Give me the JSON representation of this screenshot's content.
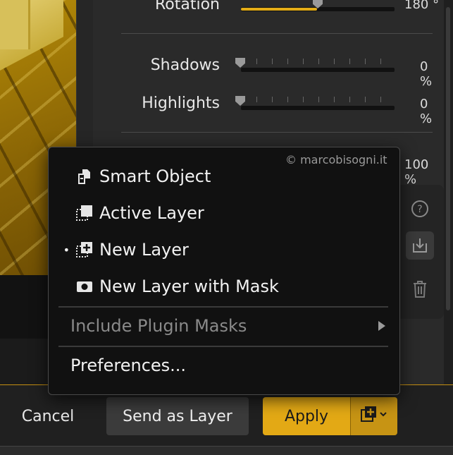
{
  "sliders": [
    {
      "label": "Rotation",
      "value": "180 °",
      "fill": 0.5
    },
    {
      "label": "Shadows",
      "value": "0 %",
      "fill": 0
    },
    {
      "label": "Highlights",
      "value": "0 %",
      "fill": 0
    }
  ],
  "partial_value": "100 %",
  "tools": {
    "help_icon": "help-icon",
    "import_icon": "import-icon",
    "trash_icon": "trash-icon"
  },
  "menu": {
    "credit": "© marcobisogni.it",
    "items": [
      {
        "label": "Smart Object",
        "icon": "smart-object-icon",
        "selected": false
      },
      {
        "label": "Active Layer",
        "icon": "active-layer-icon",
        "selected": false
      },
      {
        "label": "New Layer",
        "icon": "new-layer-icon",
        "selected": true
      },
      {
        "label": "New Layer with Mask",
        "icon": "layer-mask-icon",
        "selected": false
      }
    ],
    "submenu": {
      "label": "Include Plugin Masks",
      "enabled": false
    },
    "preferences": "Preferences..."
  },
  "bottom": {
    "cancel": "Cancel",
    "send": "Send as Layer",
    "apply": "Apply",
    "apply_menu_icon": "new-layer-dropdown-icon"
  },
  "colors": {
    "accent": "#e3a915",
    "menu_bg": "#111111",
    "panel_bg": "#2a2a2a"
  }
}
